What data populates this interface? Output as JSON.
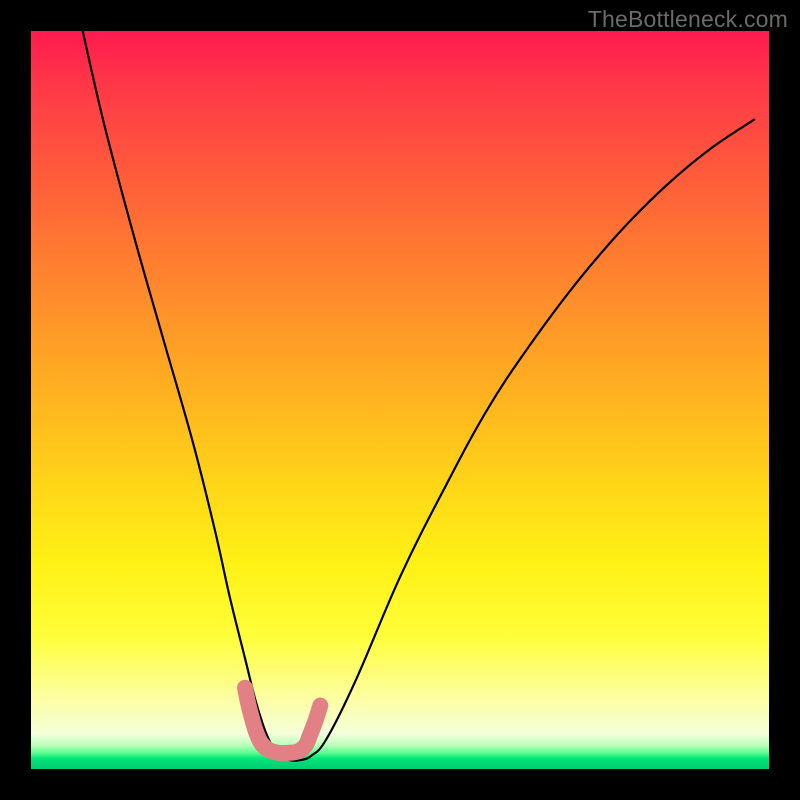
{
  "watermark": "TheBottleneck.com",
  "chart_data": {
    "type": "line",
    "title": "",
    "xlabel": "",
    "ylabel": "",
    "xlim": [
      0,
      100
    ],
    "ylim": [
      0,
      100
    ],
    "series": [
      {
        "name": "bottleneck-curve",
        "x": [
          7,
          10,
          14,
          18,
          22,
          25,
          27,
          29,
          30.5,
          32,
          33.5,
          35,
          36.5,
          38,
          40,
          44,
          50,
          56,
          62,
          68,
          74,
          80,
          86,
          92,
          98
        ],
        "y": [
          100,
          87,
          72,
          58,
          44,
          32,
          23,
          15,
          9,
          4.5,
          2.0,
          1.2,
          1.2,
          1.8,
          4,
          12,
          26,
          38,
          49,
          58,
          66,
          73,
          79,
          84,
          88
        ]
      }
    ],
    "pink_marker": {
      "comment": "small squiggle/marker cluster drawn near curve valley",
      "points_xy": [
        [
          29.0,
          11.0
        ],
        [
          29.4,
          9.0
        ],
        [
          29.9,
          7.0
        ],
        [
          30.5,
          5.0
        ],
        [
          31.2,
          3.5
        ],
        [
          32.2,
          2.6
        ],
        [
          33.5,
          2.2
        ],
        [
          35.0,
          2.2
        ],
        [
          36.2,
          2.4
        ],
        [
          37.2,
          3.2
        ],
        [
          37.8,
          4.6
        ],
        [
          38.5,
          6.4
        ],
        [
          39.2,
          8.6
        ]
      ]
    },
    "colors": {
      "curve": "#000000",
      "marker": "#e18185",
      "gradient_top": "#ff1a4e",
      "gradient_mid": "#fff115",
      "gradient_bottom": "#00cc70"
    }
  }
}
